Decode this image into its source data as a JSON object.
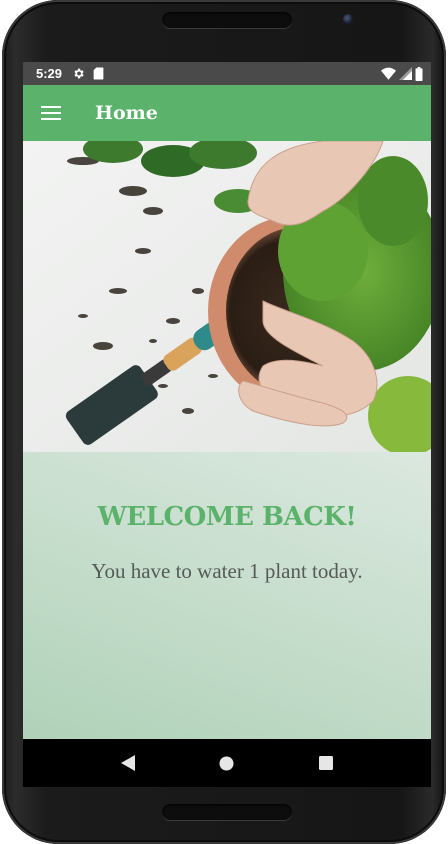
{
  "status_bar": {
    "time": "5:29",
    "icons": [
      "settings-icon",
      "sd-card-icon",
      "wifi-icon",
      "signal-icon",
      "battery-icon"
    ]
  },
  "app_bar": {
    "title": "Home",
    "menu_icon": "hamburger-menu-icon",
    "background": "#5bb36b"
  },
  "hero": {
    "description_icon": "plant-repotting-photo"
  },
  "main": {
    "welcome": "WELCOME BACK!",
    "message": "You have to water 1 plant today.",
    "accent": "#5bb36b"
  },
  "nav_bar": {
    "items": [
      "back-icon",
      "home-icon",
      "recents-icon"
    ]
  }
}
